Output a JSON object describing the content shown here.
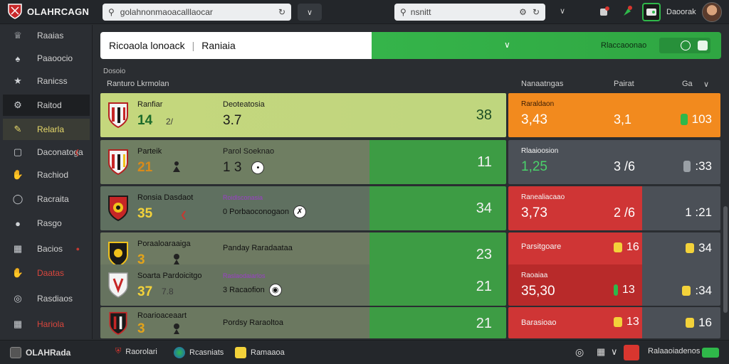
{
  "header": {
    "logo_text": "OLAHRCAGN",
    "search_main": "golahnonmaoacalllaocar",
    "search_secondary": "nsnitt",
    "balance": "Daoorak"
  },
  "sidebar": {
    "items": [
      {
        "label": "Raaias"
      },
      {
        "label": "Paaoocio"
      },
      {
        "label": "Ranicss"
      },
      {
        "label": "Raitod"
      },
      {
        "label": "Relarla"
      },
      {
        "label": "Daconatoga"
      },
      {
        "label": "Rachiod"
      },
      {
        "label": "Racraita"
      },
      {
        "label": "Rasgo"
      },
      {
        "label": "Bacios"
      },
      {
        "label": "Daatas"
      },
      {
        "label": "Rasdiaos"
      },
      {
        "label": "Hariola"
      }
    ]
  },
  "banner": {
    "title": "Ricoaola lonoack",
    "subtitle": "Raniaia",
    "arrow": "∨",
    "right_text": "Rlaccaoonao"
  },
  "section": {
    "small_label": "Dosoio",
    "col1": "Ranturo Lkrmolan",
    "col2": "Nanaatngas",
    "col3": "Pairat",
    "col4": "Ga"
  },
  "matches": [
    {
      "name": "Ranfiar",
      "num": "14",
      "sub": "2/",
      "mid_label": "Deoteatosia",
      "mid_value": "3.7",
      "right": "38"
    },
    {
      "name": "Parteik",
      "num": "21",
      "sub": "",
      "mid_label": "Parol Soeknao",
      "mid_value": "1 3",
      "right": "11"
    },
    {
      "name": "Ronsia Dasdaot",
      "num": "35",
      "sub": "",
      "tag": "Roidlsconasia",
      "line": "0  Porbaoconogaon",
      "right": "34"
    },
    {
      "name": "Poraaloaraaiga",
      "num": "3",
      "sub": "",
      "line": "Panday Raradaataa",
      "right": "23"
    },
    {
      "name": "Soarta Pardoicitgo",
      "num": "37",
      "sub": "7.8",
      "tag": "Raslaodaiarlos",
      "line": "3  Racaofion",
      "right": "21"
    },
    {
      "name": "Roarioaceaart",
      "num": "3",
      "sub": "",
      "line": "Pordsy Raraoltoa",
      "right": "21"
    }
  ],
  "odds": [
    {
      "label": "Raraldaon",
      "value": "3,43",
      "mid": "3,1",
      "right": "103"
    },
    {
      "label": "Rlaaioosion",
      "value": "1,25",
      "mid": "3 /6",
      "right": ":33"
    },
    {
      "label": "Ranealiacaao",
      "value": "3,73",
      "mid": "2 /6",
      "right": "1 :21"
    },
    {
      "label": "Parsitgoare",
      "value": "",
      "mid": "16",
      "right": "34"
    },
    {
      "label": "Raoaiaa",
      "value": "35,30",
      "mid": "13",
      "right": ":34"
    },
    {
      "label": "Barasioao",
      "value": "",
      "mid": "13",
      "right": "16"
    }
  ],
  "footer": {
    "brand": "OLAHRada",
    "item1": "Raorolari",
    "item2": "Rcasniats",
    "item3": "Ramaaoa",
    "right_text": "Ralaaoiadenos"
  },
  "colors": {
    "accent_green": "#35b44a",
    "orange": "#f28a1e",
    "red": "#cf3535",
    "dark": "#2a2d31"
  }
}
